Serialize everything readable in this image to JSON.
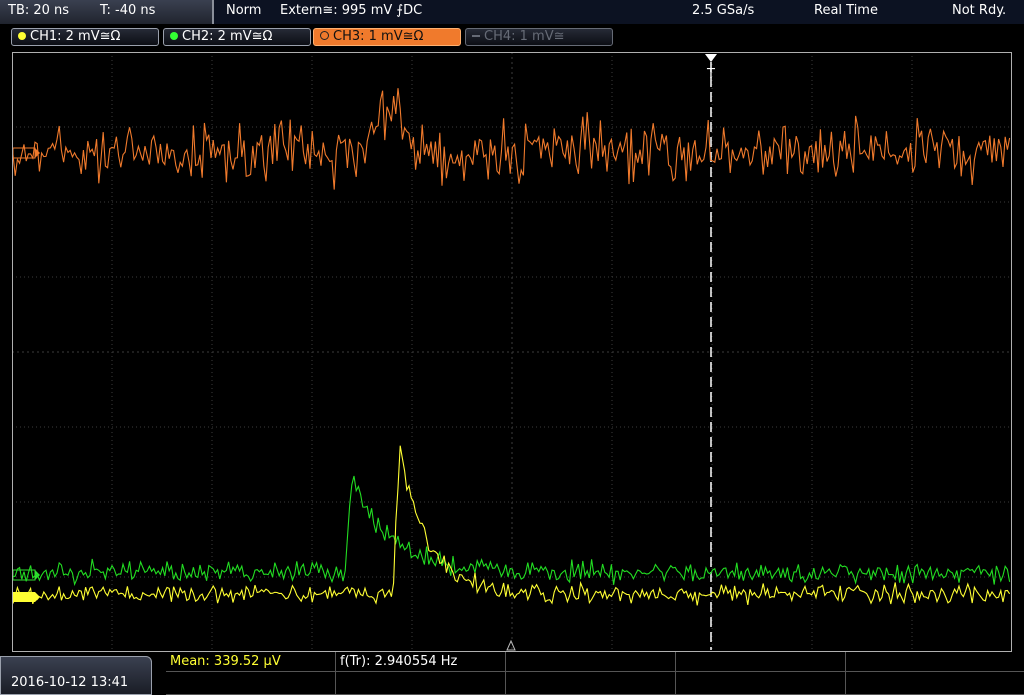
{
  "status_bar": {
    "timebase": "TB: 20 ns",
    "trigger_time": "T: -40 ns",
    "mode": "Norm",
    "trigger_source": "Extern≅: 995 mV ⨍DC",
    "sample_rate": "2.5 GSa/s",
    "acquisition": "Real Time",
    "state": "Not Rdy."
  },
  "channels": [
    {
      "label": "CH1: 2 mV≅Ω",
      "color": "#ffff33"
    },
    {
      "label": "CH2: 2 mV≅Ω",
      "color": "#33ff33"
    },
    {
      "label": "CH3: 1 mV≅Ω",
      "color": "#f07a2c"
    },
    {
      "label": "CH4: 1 mV≅",
      "color": "#666b76"
    }
  ],
  "trigger_marker": "T",
  "measurements": {
    "datetime": "2016-10-12 13:41",
    "mean": "Mean: 339.52 µV",
    "frequency": "f(Tr): 2.940554 Hz"
  },
  "colors": {
    "ch1": "#ffff33",
    "ch2": "#22dd22",
    "ch3": "#f07a2c",
    "grid": "#3c3c3c",
    "background": "#000000"
  }
}
